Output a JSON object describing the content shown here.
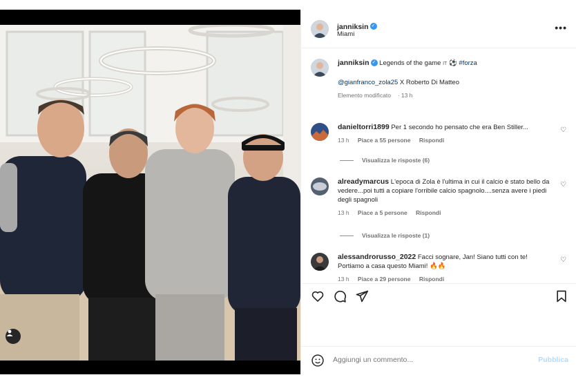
{
  "post": {
    "username": "janniksin",
    "verified_mark": "✓",
    "location": "Miami",
    "more_icon": "more-horizontal-icon",
    "caption": {
      "text": "Legends of the game",
      "emoji_flag": "IT",
      "emoji_ball": "⚽",
      "hashtag": "#forza",
      "mention": "@gianfranco_zola25",
      "mention_rest": " X Roberto Di Matteo",
      "edited": "Elemento modificato",
      "time": "13 h"
    },
    "photo_alt": "Four men posing together in a restaurant"
  },
  "comments": [
    {
      "username": "danieltorri1899",
      "text": "Per 1 secondo ho pensato che era Ben Stiller...",
      "time": "13 h",
      "likes": "Piace a 55 persone",
      "reply": "Rispondi",
      "view_replies": "Visualizza le risposte (6)"
    },
    {
      "username": "alreadymarcus",
      "text": "L'epoca di Zola è l'ultima in cui il calcio è stato bello da vedere...poi tutti a copiare l'orribile calcio spagnolo....senza avere i piedi degli spagnoli",
      "time": "13 h",
      "likes": "Piace a 5 persone",
      "reply": "Rispondi",
      "view_replies": "Visualizza le risposte (1)"
    },
    {
      "username": "alessandrorusso_2022",
      "text": "Facci sognare, Jan! Siano tutti con te! Portiamo a casa questo Miami! 🔥🔥",
      "time": "13 h",
      "likes": "Piace a 29 persone",
      "reply": "Rispondi"
    }
  ],
  "composer": {
    "placeholder": "Aggiungi un commento...",
    "publish": "Pubblica"
  },
  "colors": {
    "accent": "#3797f0",
    "publish_disabled": "#b3dbff",
    "link": "#00376b"
  }
}
